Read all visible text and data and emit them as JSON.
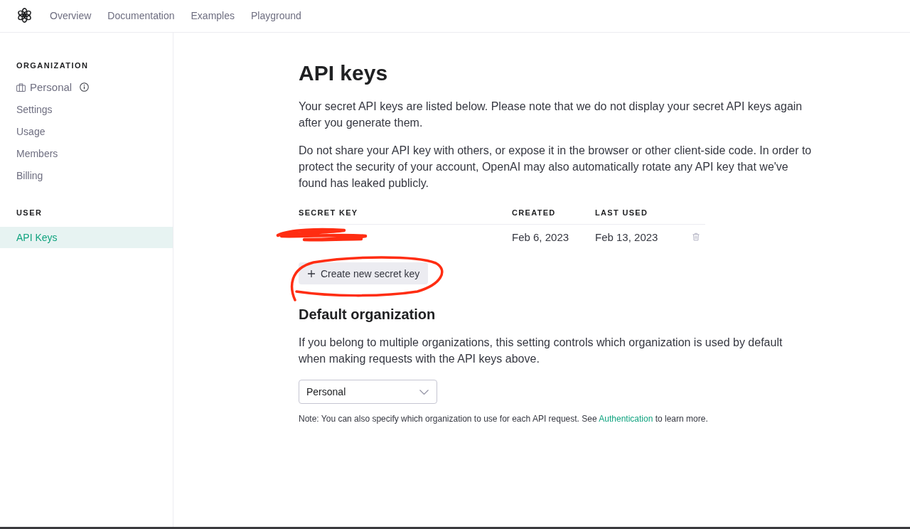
{
  "nav": {
    "links": [
      {
        "label": "Overview"
      },
      {
        "label": "Documentation"
      },
      {
        "label": "Examples"
      },
      {
        "label": "Playground"
      }
    ]
  },
  "sidebar": {
    "sections": [
      {
        "heading": "ORGANIZATION",
        "items": [
          {
            "label": "Personal",
            "kind": "organization",
            "selected": false
          },
          {
            "label": "Settings",
            "kind": "link",
            "selected": false
          },
          {
            "label": "Usage",
            "kind": "link",
            "selected": false
          },
          {
            "label": "Members",
            "kind": "link",
            "selected": false
          },
          {
            "label": "Billing",
            "kind": "link",
            "selected": false
          }
        ]
      },
      {
        "heading": "USER",
        "items": [
          {
            "label": "API Keys",
            "kind": "link",
            "selected": true
          }
        ]
      }
    ]
  },
  "page": {
    "title": "API keys",
    "paragraphs": [
      "Your secret API keys are listed below. Please note that we do not display your secret API keys again after you generate them.",
      "Do not share your API key with others, or expose it in the browser or other client-side code. In order to protect the security of your account, OpenAI may also automatically rotate any API key that we've found has leaked publicly."
    ]
  },
  "keys_table": {
    "columns": [
      "SECRET KEY",
      "CREATED",
      "LAST USED"
    ],
    "rows": [
      {
        "scribbled_over": true,
        "created": "Feb 6, 2023",
        "last_used": "Feb 13, 2023"
      }
    ]
  },
  "create_button": {
    "label": "Create new secret key",
    "circled": true
  },
  "default_organization": {
    "heading": "Default organization",
    "description": "If you belong to multiple organizations, this setting controls which organization is used by default when making requests with the API keys above.",
    "select": {
      "value": "Personal"
    },
    "note": {
      "before": "Note: You can also specify which organization to use for each API request. See ",
      "link": "Authentication",
      "after": " to learn more."
    }
  }
}
